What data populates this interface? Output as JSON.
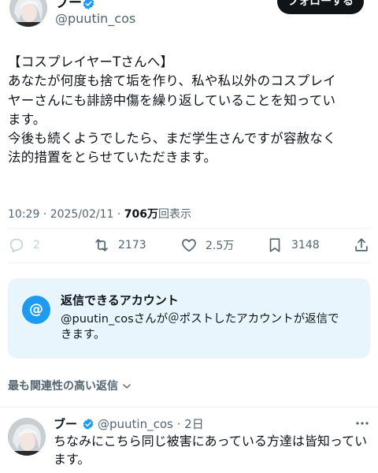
{
  "author": {
    "name": "ブー",
    "handle": "@puutin_cos",
    "follow_label": "フォローする"
  },
  "tweet": {
    "lines": [
      "【コスプレイヤーTさんへ】",
      "あなたが何度も捨て垢を作り、私や私以外のコスプレイ",
      "ヤーさんにも誹謗中傷を繰り返していることを知ってい",
      "ます。",
      "今後も続くようでしたら、まだ学生さんですが容赦なく",
      "法的措置をとらせていただきます。"
    ],
    "time": "10:29 · 2025/02/11 · ",
    "views": "706万",
    "views_suffix": "回表示"
  },
  "actions": {
    "replies": "2",
    "retweets": "2173",
    "likes": "2.5万",
    "bookmarks": "3148"
  },
  "reply_restriction": {
    "icon": "at-icon",
    "title": "返信できるアカウント",
    "desc_lines": [
      "@puutin_cosさんが＠ポストしたアカウントが返信で",
      "きます。"
    ]
  },
  "sort_label": "最も関連性の高い返信",
  "reply": {
    "name": "ブー",
    "handle_time": "@puutin_cos · 2日",
    "lines": [
      "ちなみにこちら同じ被害にあっている方達は皆知ってい",
      "ます。"
    ]
  },
  "colors": {
    "accent": "#1d9bf0",
    "text": "#0f1419",
    "secondary": "#536471",
    "card_bg": "#e8f5fd"
  }
}
